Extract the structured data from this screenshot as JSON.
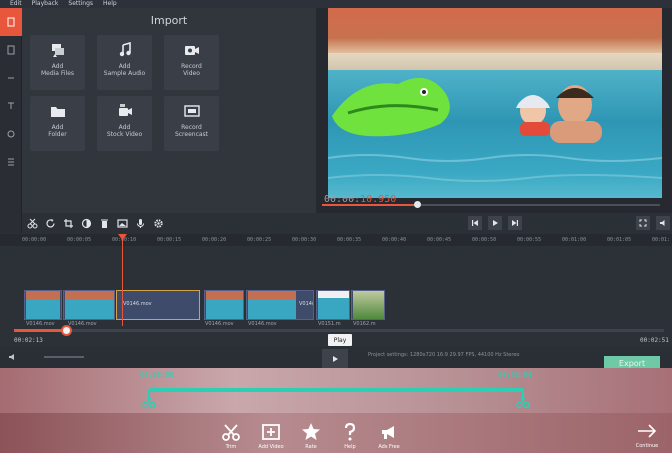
{
  "menu": {
    "items": [
      "Edit",
      "Playback",
      "Settings",
      "Help"
    ]
  },
  "import": {
    "title": "Import",
    "tiles": [
      {
        "label": "Add\nMedia Files",
        "icon": "media-files-icon"
      },
      {
        "label": "Add\nSample Audio",
        "icon": "music-note-icon"
      },
      {
        "label": "Record\nVideo",
        "icon": "camera-icon"
      },
      {
        "label": "Add\nFolder",
        "icon": "folder-icon"
      },
      {
        "label": "Add\nStock Video",
        "icon": "stock-video-icon"
      },
      {
        "label": "Record\nScreencast",
        "icon": "screencast-icon"
      }
    ]
  },
  "preview": {
    "timecode_prefix": "00:00:",
    "timecode_value": "10.950",
    "progress": 0.28
  },
  "ruler": {
    "ticks": [
      "00:00:00",
      "00:00:05",
      "00:00:10",
      "00:00:15",
      "00:00:20",
      "00:00:25",
      "00:00:30",
      "00:00:35",
      "00:00:40",
      "00:00:45",
      "00:00:50",
      "00:00:55",
      "00:01:00",
      "00:01:05",
      "00:01:"
    ]
  },
  "clips": [
    {
      "name": "",
      "label": "V0146.mov"
    },
    {
      "name": "",
      "label": "V0146.mov"
    },
    {
      "name": "V0146.mov",
      "label": ""
    },
    {
      "name": "",
      "label": "V0146.mov"
    },
    {
      "name": "V014(",
      "label": "V0146.mov"
    },
    {
      "name": "",
      "label": "V0151.m"
    },
    {
      "name": "",
      "label": "V0162.m"
    }
  ],
  "scrub": {
    "current": "00:02:13",
    "total": "00:02:51",
    "progress": 0.08
  },
  "tooltip": {
    "play": "Play"
  },
  "status": {
    "project_settings": "Project settings:  1280x720 16:9 29.97 FPS, 44100 Hz Stereo"
  },
  "export_label": "Export",
  "trim": {
    "start": "00:00:00",
    "end": "00:03:04"
  },
  "actions": [
    {
      "label": "Trim",
      "icon": "scissors-icon"
    },
    {
      "label": "Add Video",
      "icon": "add-video-icon"
    },
    {
      "label": "Rate",
      "icon": "star-icon"
    },
    {
      "label": "Help",
      "icon": "question-icon"
    },
    {
      "label": "Ads Free",
      "icon": "megaphone-icon"
    }
  ],
  "continue_label": "Continue",
  "colors": {
    "accent": "#e8563c",
    "trim": "#2bd0b4",
    "export": "#6fc9a7"
  }
}
